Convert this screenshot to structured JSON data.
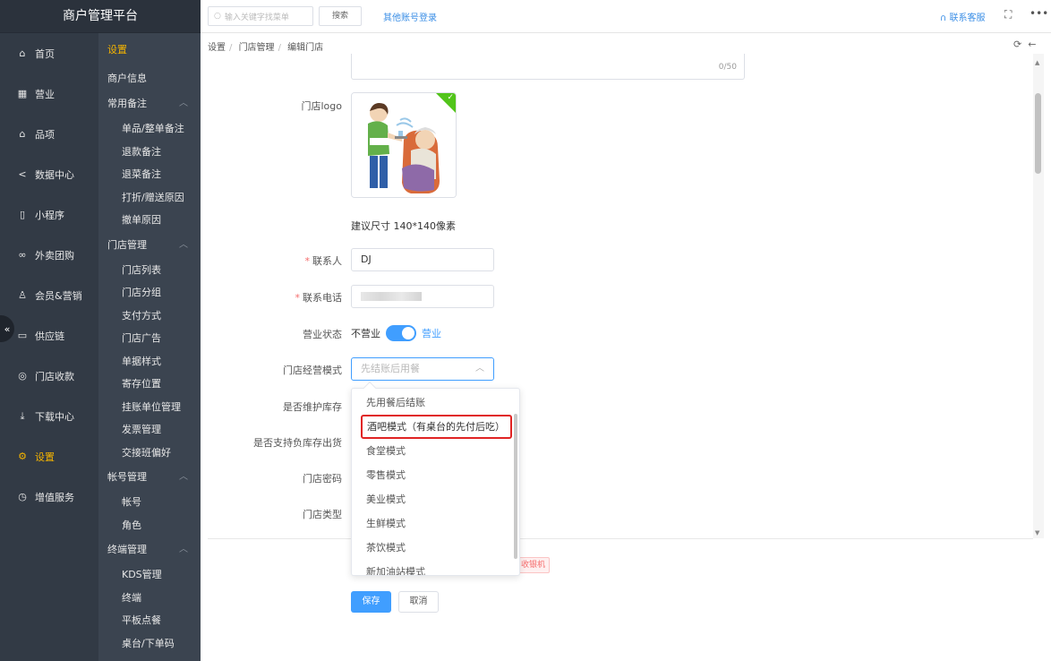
{
  "app": {
    "title": "商户管理平台"
  },
  "rail": {
    "items": [
      {
        "label": "首页",
        "icon": "home-icon"
      },
      {
        "label": "营业",
        "icon": "calendar-icon"
      },
      {
        "label": "品项",
        "icon": "bag-icon"
      },
      {
        "label": "数据中心",
        "icon": "share-icon"
      },
      {
        "label": "小程序",
        "icon": "phone-icon"
      },
      {
        "label": "外卖团购",
        "icon": "bike-icon"
      },
      {
        "label": "会员&营销",
        "icon": "user-icon"
      },
      {
        "label": "供应链",
        "icon": "truck-icon"
      },
      {
        "label": "门店收款",
        "icon": "coins-icon"
      },
      {
        "label": "下载中心",
        "icon": "download-icon"
      },
      {
        "label": "设置",
        "icon": "gear-icon"
      },
      {
        "label": "增值服务",
        "icon": "clock-icon"
      }
    ],
    "active_index": 10
  },
  "submenu": {
    "title": "设置",
    "merchant_info": "商户信息",
    "groups": [
      {
        "label": "常用备注",
        "items": [
          "单品/整单备注",
          "退款备注",
          "退菜备注",
          "打折/赠送原因",
          "撤单原因"
        ]
      },
      {
        "label": "门店管理",
        "items": [
          "门店列表",
          "门店分组",
          "支付方式",
          "门店广告",
          "单据样式",
          "寄存位置",
          "挂账单位管理",
          "发票管理",
          "交接班偏好"
        ]
      },
      {
        "label": "帐号管理",
        "items": [
          "帐号",
          "角色"
        ]
      },
      {
        "label": "终端管理",
        "items": [
          "KDS管理",
          "终端",
          "平板点餐",
          "桌台/下单码"
        ]
      }
    ]
  },
  "topbar": {
    "search_placeholder": "输入关键字找菜单",
    "search_button": "搜索",
    "other_login": "其他账号登录",
    "contact": "联系客服"
  },
  "breadcrumb": [
    "设置",
    "门店管理",
    "编辑门店"
  ],
  "form": {
    "textarea_counter": "0/50",
    "logo_label": "门店logo",
    "logo_hint": "建议尺寸 140*140像素",
    "contact_label": "联系人",
    "contact_value": "DJ",
    "phone_label": "联系电话",
    "status_label": "营业状态",
    "status_off": "不营业",
    "status_on": "营业",
    "status_value_on": true,
    "mode_label": "门店经营模式",
    "mode_placeholder": "先结账后用餐",
    "inventory_label": "是否维护库存",
    "negative_label": "是否支持负库存出货",
    "password_label": "门店密码",
    "type_label": "门店类型",
    "tag_text": "收银机",
    "save": "保存",
    "cancel": "取消"
  },
  "dropdown": {
    "options": [
      "先用餐后结账",
      "酒吧模式（有桌台的先付后吃）",
      "食堂模式",
      "零售模式",
      "美业模式",
      "生鲜模式",
      "茶饮模式",
      "新加油站模式"
    ],
    "highlighted_index": 1
  }
}
